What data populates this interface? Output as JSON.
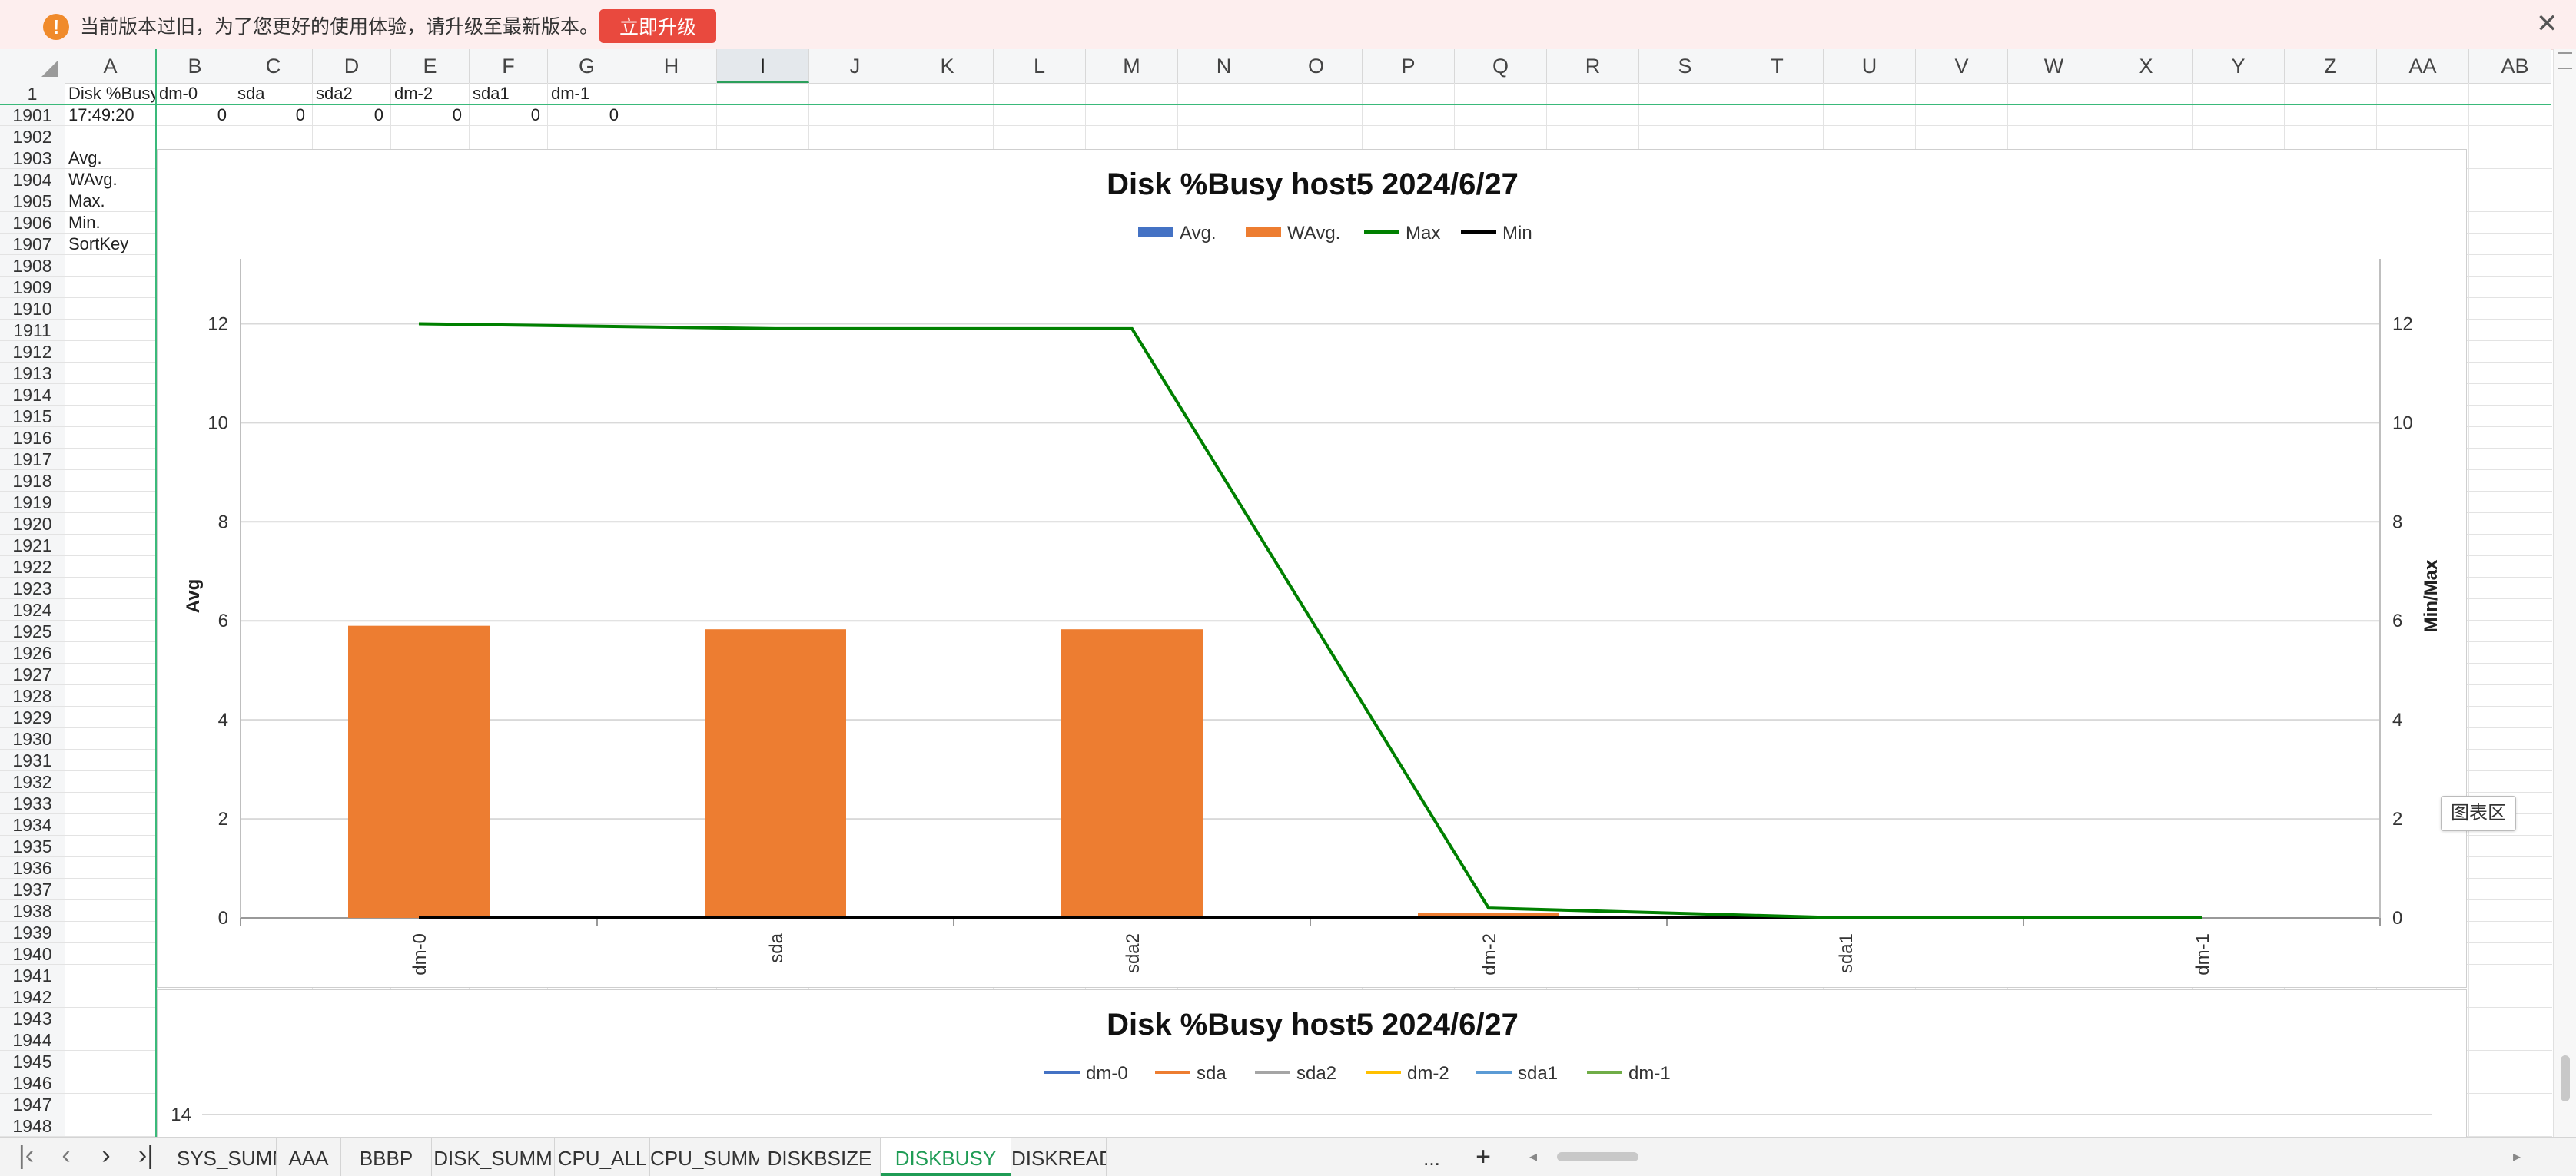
{
  "banner": {
    "icon": "warning-icon",
    "message": "当前版本过旧，为了您更好的使用体验，请升级至最新版本。",
    "upgrade_label": "立即升级",
    "close_icon": "close-icon"
  },
  "columns": [
    "A",
    "B",
    "C",
    "D",
    "E",
    "F",
    "G",
    "H",
    "I",
    "J",
    "K",
    "L",
    "M",
    "N",
    "O",
    "P",
    "Q",
    "R",
    "S",
    "T",
    "U",
    "V",
    "W",
    "X",
    "Y",
    "Z",
    "AA",
    "AB"
  ],
  "selected_column": "I",
  "rows": [
    "1",
    "1901",
    "1902",
    "1903",
    "1904",
    "1905",
    "1906",
    "1907",
    "1908",
    "1909",
    "1910",
    "1911",
    "1912",
    "1913",
    "1914",
    "1915",
    "1916",
    "1917",
    "1918",
    "1919",
    "1920",
    "1921",
    "1922",
    "1923",
    "1924",
    "1925",
    "1926",
    "1927",
    "1928",
    "1929",
    "1930",
    "1931",
    "1932",
    "1933",
    "1934",
    "1935",
    "1936",
    "1937",
    "1938",
    "1939",
    "1940",
    "1941",
    "1942",
    "1943",
    "1944",
    "1945",
    "1946",
    "1947",
    "1948"
  ],
  "cells": {
    "r1": [
      "Disk  %Busy",
      "dm-0",
      "sda",
      "sda2",
      "dm-2",
      "sda1",
      "dm-1"
    ],
    "r1901": [
      "17:49:20",
      "0",
      "0",
      "0",
      "0",
      "0",
      "0"
    ],
    "stats": [
      "Avg.",
      "WAvg.",
      "Max.",
      "Min.",
      "SortKey"
    ]
  },
  "chart_data": [
    {
      "type": "bar",
      "title": "Disk %Busy host5  2024/6/27",
      "categories": [
        "dm-0",
        "sda",
        "sda2",
        "dm-2",
        "sda1",
        "dm-1"
      ],
      "series": [
        {
          "name": "Avg.",
          "kind": "bar",
          "axis": "left",
          "color": "#4472c4",
          "values": [
            0.03,
            0.01,
            0.01,
            0.0,
            0.0,
            0.0
          ]
        },
        {
          "name": "WAvg.",
          "kind": "bar",
          "axis": "left",
          "color": "#ed7d31",
          "values": [
            5.9,
            5.83,
            5.83,
            0.1,
            0.0,
            0.0
          ]
        },
        {
          "name": "Max",
          "kind": "line",
          "axis": "right",
          "color": "#008000",
          "values": [
            12.0,
            11.9,
            11.9,
            0.2,
            0.0,
            0.0
          ]
        },
        {
          "name": "Min",
          "kind": "line",
          "axis": "right",
          "color": "#000000",
          "values": [
            0,
            0,
            0,
            0,
            0,
            0
          ]
        }
      ],
      "ylabel": "Avg",
      "y2label": "Min/Max",
      "ylim": [
        0,
        13
      ],
      "y2lim": [
        0,
        13
      ],
      "yticks": [
        0,
        2,
        4,
        6,
        8,
        10,
        12
      ],
      "grid": true,
      "legend": "top"
    },
    {
      "type": "line",
      "title": "Disk %Busy host5  2024/6/27",
      "series": [
        {
          "name": "dm-0",
          "color": "#4472c4"
        },
        {
          "name": "sda",
          "color": "#ed7d31"
        },
        {
          "name": "sda2",
          "color": "#a5a5a5"
        },
        {
          "name": "dm-2",
          "color": "#ffc000"
        },
        {
          "name": "sda1",
          "color": "#5b9bd5"
        },
        {
          "name": "dm-1",
          "color": "#70ad47"
        }
      ],
      "yticks": [
        14
      ],
      "legend": "top"
    }
  ],
  "tooltip": "图表区",
  "tabs": [
    "SYS_SUMM",
    "AAA",
    "BBBP",
    "DISK_SUMM",
    "CPU_ALL",
    "CPU_SUMM",
    "DISKBSIZE",
    "DISKBUSY",
    "DISKREAD"
  ],
  "active_tab": "DISKBUSY",
  "tab_more": "...",
  "tab_add": "+",
  "nav_icons": [
    "first-sheet-icon",
    "prev-sheet-icon",
    "next-sheet-icon",
    "last-sheet-icon"
  ]
}
